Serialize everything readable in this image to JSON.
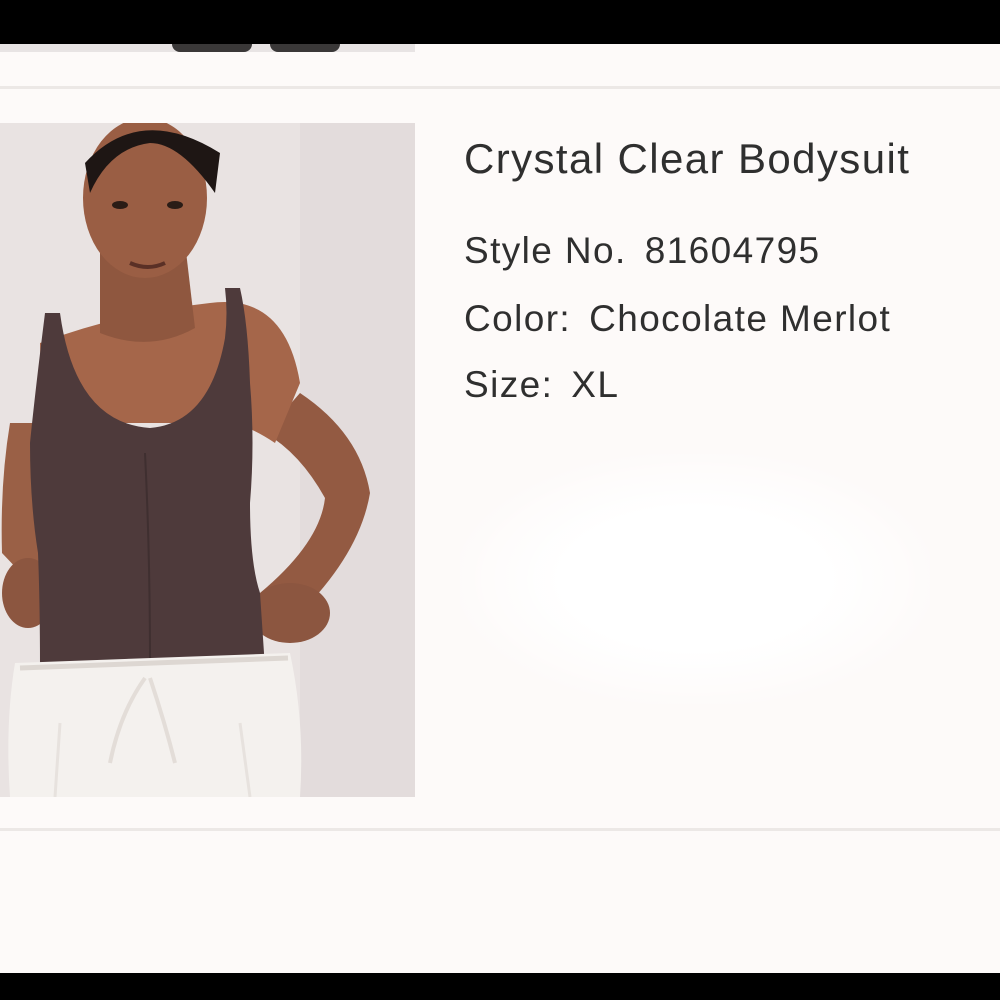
{
  "product": {
    "title": "Crystal Clear Bodysuit",
    "style": {
      "label": "Style No.",
      "value": "81604795"
    },
    "color": {
      "label": "Color:",
      "value": "Chocolate Merlot"
    },
    "size": {
      "label": "Size:",
      "value": "XL"
    },
    "image": "model wearing chocolate merlot sleeveless bodysuit with white drawstring pants"
  },
  "colors": {
    "page_background": "#fdfaf9",
    "bodysuit": "#4e3a3b",
    "text": "#2f2f2f"
  }
}
